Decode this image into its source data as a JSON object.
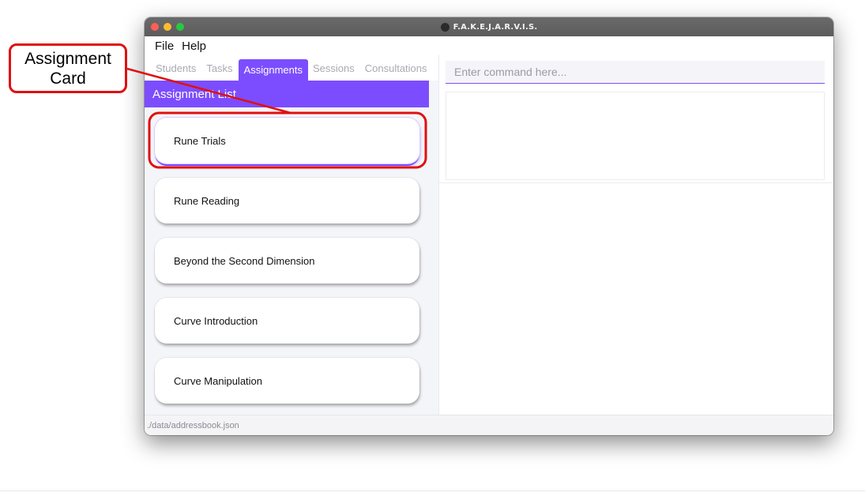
{
  "callout": {
    "text": "Assignment\nCard",
    "border_color": "#e01010"
  },
  "window": {
    "title": "F.A.K.E.J.A.R.V.I.S."
  },
  "menu": {
    "items": [
      "File",
      "Help"
    ]
  },
  "tabs": [
    {
      "label": "Students",
      "active": false
    },
    {
      "label": "Tasks",
      "active": false
    },
    {
      "label": "Assignments",
      "active": true
    },
    {
      "label": "Sessions",
      "active": false
    },
    {
      "label": "Consultations",
      "active": false
    }
  ],
  "assignment_list": {
    "header": "Assignment List",
    "items": [
      {
        "label": "Rune Trials",
        "selected": true
      },
      {
        "label": "Rune Reading",
        "selected": false
      },
      {
        "label": "Beyond the Second Dimension",
        "selected": false
      },
      {
        "label": "Curve Introduction",
        "selected": false
      },
      {
        "label": "Curve Manipulation",
        "selected": false
      }
    ]
  },
  "command": {
    "placeholder": "Enter command here..."
  },
  "status": {
    "path": "./data/addressbook.json"
  },
  "colors": {
    "accent": "#7c4dff",
    "callout": "#e01010"
  }
}
